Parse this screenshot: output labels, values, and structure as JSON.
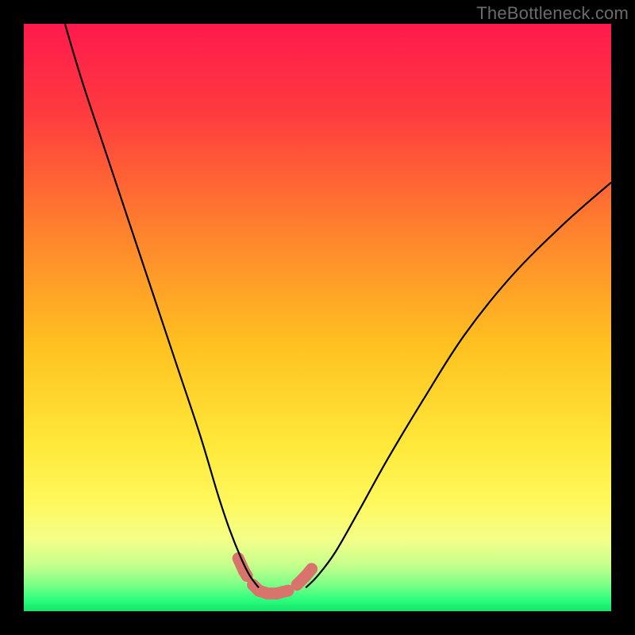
{
  "watermark": "TheBottleneck.com",
  "chart_data": {
    "type": "line",
    "title": "",
    "xlabel": "",
    "ylabel": "",
    "xlim": [
      0,
      100
    ],
    "ylim": [
      0,
      100
    ],
    "grid": false,
    "legend": false,
    "series": [
      {
        "name": "left-curve",
        "x": [
          7,
          10,
          14,
          18,
          22,
          26,
          30,
          33,
          35,
          37,
          38.5,
          40
        ],
        "y": [
          100,
          90,
          78,
          66,
          54,
          42,
          30,
          20,
          14,
          9,
          6,
          4
        ]
      },
      {
        "name": "right-curve",
        "x": [
          48,
          50,
          53,
          57,
          62,
          68,
          75,
          83,
          92,
          100
        ],
        "y": [
          4,
          6,
          10,
          17,
          26,
          36,
          47,
          57,
          66,
          73
        ]
      },
      {
        "name": "coral-segments",
        "x": [
          36.5,
          37.5,
          38,
          39,
          40,
          41.5,
          43,
          45,
          46.5,
          48,
          49
        ],
        "y": [
          9,
          6.8,
          6,
          4.5,
          3.5,
          3,
          3,
          3.5,
          4.5,
          6,
          7.2
        ]
      }
    ],
    "background_gradient": {
      "stops": [
        {
          "pos": 0.0,
          "color": "#ff1a4d"
        },
        {
          "pos": 0.15,
          "color": "#ff3a3f"
        },
        {
          "pos": 0.33,
          "color": "#ff7a2f"
        },
        {
          "pos": 0.55,
          "color": "#ffc220"
        },
        {
          "pos": 0.72,
          "color": "#ffe93a"
        },
        {
          "pos": 0.82,
          "color": "#fff95f"
        },
        {
          "pos": 0.88,
          "color": "#f2ff8a"
        },
        {
          "pos": 0.92,
          "color": "#c8ff8c"
        },
        {
          "pos": 0.955,
          "color": "#7dff88"
        },
        {
          "pos": 0.98,
          "color": "#2dff7d"
        },
        {
          "pos": 1.0,
          "color": "#14e56c"
        }
      ]
    },
    "coral_color": "#d9746c",
    "line_color": "#000000"
  }
}
